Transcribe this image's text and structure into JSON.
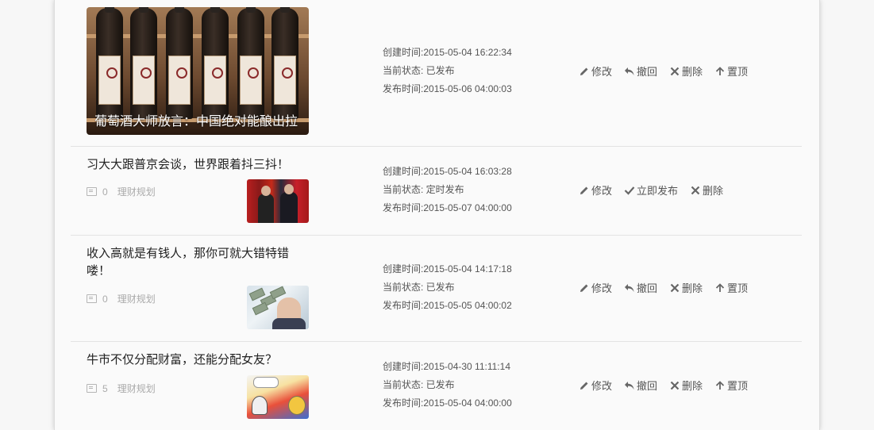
{
  "labels": {
    "created_prefix": "创建时间:",
    "status_prefix": "当前状态: ",
    "published_prefix": "发布时间:"
  },
  "articles": [
    {
      "cover_title": "葡萄酒大师放言：中国绝对能酿出拉",
      "created": "2015-05-04 16:22:34",
      "status": "已发布",
      "published": "2015-05-06 04:00:03",
      "actions": [
        "修改",
        "撤回",
        "删除",
        "置顶"
      ],
      "action_icons": [
        "pencil-icon",
        "undo-icon",
        "close-icon",
        "arrow-up-icon"
      ]
    },
    {
      "title": "习大大跟普京会谈，世界跟着抖三抖！",
      "comments": "0",
      "category": "理财规划",
      "created": "2015-05-04 16:03:28",
      "status": "定时发布",
      "published": "2015-05-07 04:00:00",
      "actions": [
        "修改",
        "立即发布",
        "删除"
      ],
      "action_icons": [
        "pencil-icon",
        "check-icon",
        "close-icon"
      ]
    },
    {
      "title": "收入高就是有钱人，那你可就大错特错喽！",
      "comments": "0",
      "category": "理财规划",
      "created": "2015-05-04 14:17:18",
      "status": "已发布",
      "published": "2015-05-05 04:00:02",
      "actions": [
        "修改",
        "撤回",
        "删除",
        "置顶"
      ],
      "action_icons": [
        "pencil-icon",
        "undo-icon",
        "close-icon",
        "arrow-up-icon"
      ]
    },
    {
      "title": "牛市不仅分配财富，还能分配女友？",
      "comments": "5",
      "category": "理财规划",
      "created": "2015-04-30 11:11:14",
      "status": "已发布",
      "published": "2015-05-04 04:00:00",
      "actions": [
        "修改",
        "撤回",
        "删除",
        "置顶"
      ],
      "action_icons": [
        "pencil-icon",
        "undo-icon",
        "close-icon",
        "arrow-up-icon"
      ]
    }
  ]
}
